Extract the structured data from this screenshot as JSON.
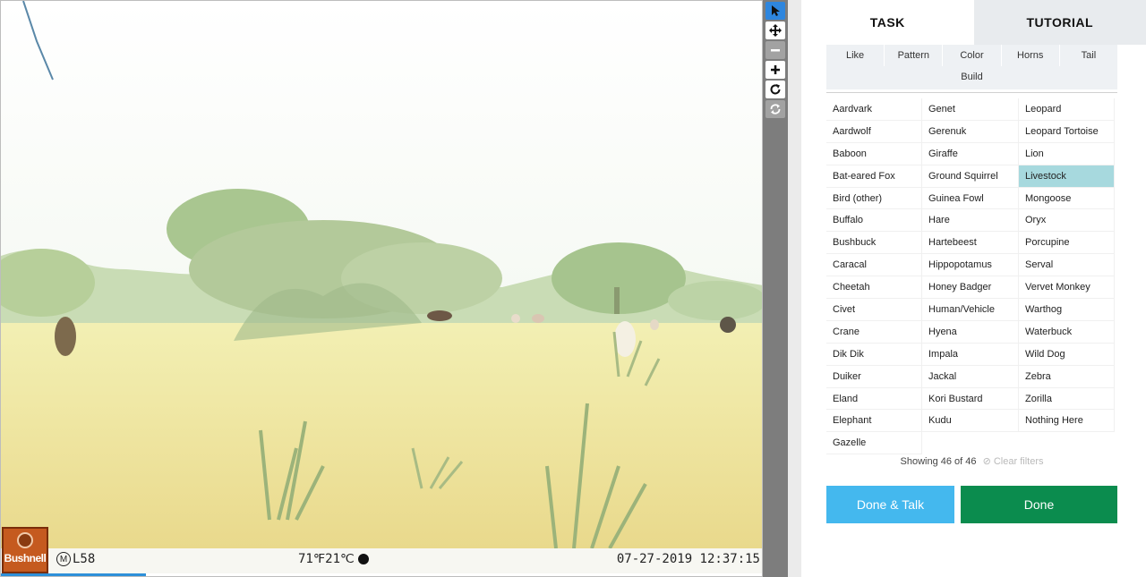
{
  "viewer": {
    "brand": "Bushnell",
    "moon_badge": "M",
    "camera_model": "L58",
    "temperature": "71℉21℃",
    "timestamp": "07-27-2019 12:37:15",
    "load_progress": 0.19
  },
  "toolbar": {
    "tools": [
      {
        "name": "select-tool",
        "icon": "cursor-icon",
        "state": "active"
      },
      {
        "name": "pan-tool",
        "icon": "move-icon",
        "state": "normal"
      },
      {
        "name": "zoom-out-tool",
        "icon": "minus-icon",
        "state": "disabled"
      },
      {
        "name": "zoom-in-tool",
        "icon": "plus-icon",
        "state": "normal"
      },
      {
        "name": "rotate-tool",
        "icon": "rotate-icon",
        "state": "normal"
      },
      {
        "name": "reset-tool",
        "icon": "refresh-icon",
        "state": "disabled"
      }
    ]
  },
  "tabs": [
    {
      "label": "TASK",
      "active": true
    },
    {
      "label": "TUTORIAL",
      "active": false
    }
  ],
  "filters": [
    "Like",
    "Pattern",
    "Color",
    "Horns",
    "Tail",
    "Build"
  ],
  "species": {
    "columns": [
      [
        "Aardvark",
        "Aardwolf",
        "Baboon",
        "Bat-eared Fox",
        "Bird (other)",
        "Buffalo",
        "Bushbuck",
        "Caracal",
        "Cheetah",
        "Civet",
        "Crane",
        "Dik Dik",
        "Duiker",
        "Eland",
        "Elephant",
        "Gazelle"
      ],
      [
        "Genet",
        "Gerenuk",
        "Giraffe",
        "Ground Squirrel",
        "Guinea Fowl",
        "Hare",
        "Hartebeest",
        "Hippopotamus",
        "Honey Badger",
        "Human/Vehicle",
        "Hyena",
        "Impala",
        "Jackal",
        "Kori Bustard",
        "Kudu"
      ],
      [
        "Leopard",
        "Leopard Tortoise",
        "Lion",
        "Livestock",
        "Mongoose",
        "Oryx",
        "Porcupine",
        "Serval",
        "Vervet Monkey",
        "Warthog",
        "Waterbuck",
        "Wild Dog",
        "Zebra",
        "Zorilla",
        "Nothing Here"
      ]
    ],
    "selected": "Livestock",
    "selected_color": "#a7d9de"
  },
  "showing": {
    "text": "Showing 46 of 46",
    "clear_label": "Clear filters",
    "clear_icon": "ban-icon"
  },
  "actions": {
    "done_talk": "Done & Talk",
    "done": "Done",
    "done_talk_color": "#44b8ee",
    "done_color": "#0b8c4e"
  }
}
